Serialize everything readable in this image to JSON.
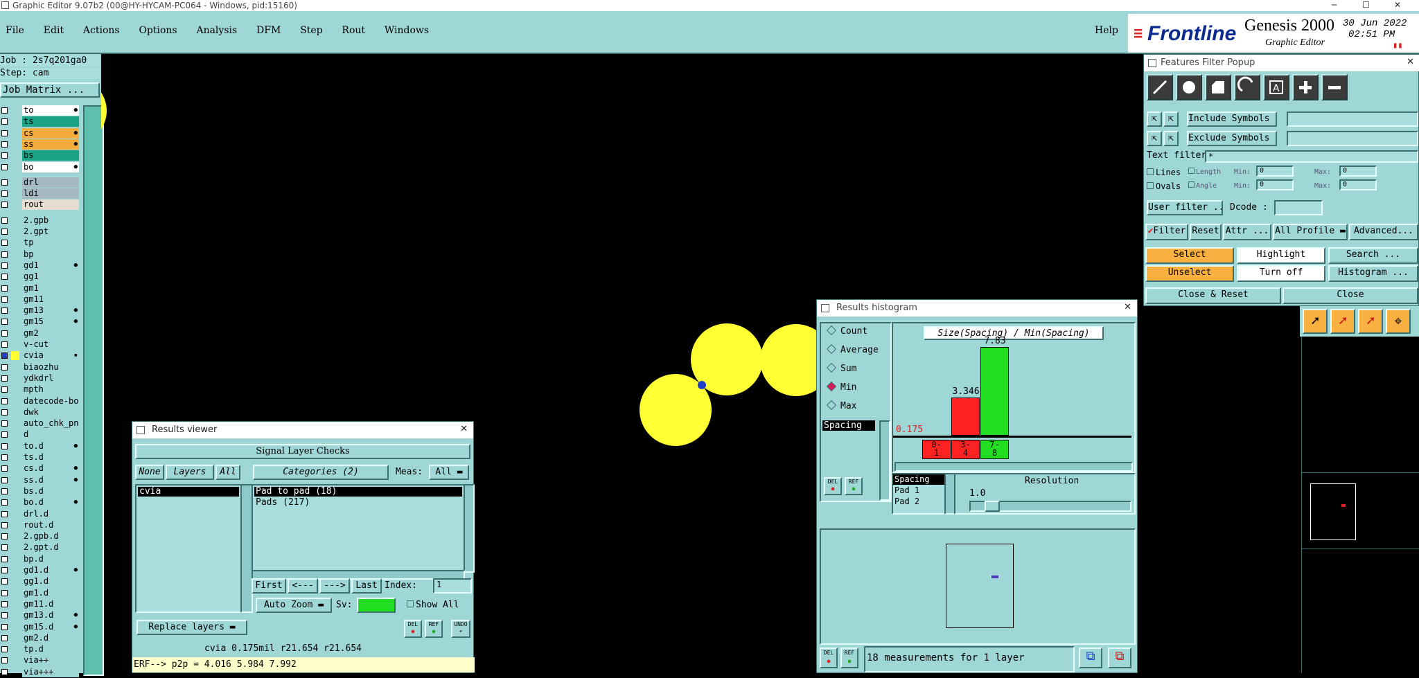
{
  "titlebar": {
    "title": "Graphic Editor 9.07b2 (00@HY-HYCAM-PC064 - Windows, pid:15160)"
  },
  "menu": {
    "items": [
      "File",
      "Edit",
      "Actions",
      "Options",
      "Analysis",
      "DFM",
      "Step",
      "Rout",
      "Windows"
    ],
    "help": "Help"
  },
  "brand": {
    "logo": "Frontline",
    "product": "Genesis 2000",
    "subtitle": "Graphic Editor",
    "date": "30 Jun 2022",
    "time": "02:51 PM"
  },
  "job": {
    "job_label": "Job : 2s7q201ga0",
    "step_label": "Step: cam",
    "matrix_button": "Job Matrix ..."
  },
  "layers": [
    {
      "name": "to",
      "color": "#ffffff",
      "flag": "●"
    },
    {
      "name": "ts",
      "color": "#1aa386",
      "flag": ""
    },
    {
      "name": "cs",
      "color": "#f4ad3c",
      "flag": "●"
    },
    {
      "name": "ss",
      "color": "#f4ad3c",
      "flag": "●"
    },
    {
      "name": "bs",
      "color": "#1aa386",
      "flag": ""
    },
    {
      "name": "bo",
      "color": "#ffffff",
      "flag": "●"
    },
    {
      "name": "drl",
      "color": "#a6b9c0",
      "flag": ""
    },
    {
      "name": "ldi",
      "color": "#a6b9c0",
      "flag": ""
    },
    {
      "name": "rout",
      "color": "#e6dcd2",
      "flag": ""
    },
    {
      "name": "2.gpb",
      "color": "#9fd6d6",
      "flag": ""
    },
    {
      "name": "2.gpt",
      "color": "#9fd6d6",
      "flag": ""
    },
    {
      "name": "tp",
      "color": "#9fd6d6",
      "flag": ""
    },
    {
      "name": "bp",
      "color": "#9fd6d6",
      "flag": ""
    },
    {
      "name": "gd1",
      "color": "#9fd6d6",
      "flag": "●"
    },
    {
      "name": "gg1",
      "color": "#9fd6d6",
      "flag": ""
    },
    {
      "name": "gm1",
      "color": "#9fd6d6",
      "flag": ""
    },
    {
      "name": "gm11",
      "color": "#9fd6d6",
      "flag": ""
    },
    {
      "name": "gm13",
      "color": "#9fd6d6",
      "flag": "●"
    },
    {
      "name": "gm15",
      "color": "#9fd6d6",
      "flag": "●"
    },
    {
      "name": "gm2",
      "color": "#9fd6d6",
      "flag": ""
    },
    {
      "name": "v-cut",
      "color": "#9fd6d6",
      "flag": ""
    },
    {
      "name": "cvia",
      "color": "#9fd6d6",
      "flag": "▪"
    },
    {
      "name": "biaozhu",
      "color": "#9fd6d6",
      "flag": ""
    },
    {
      "name": "ydkdrl",
      "color": "#9fd6d6",
      "flag": ""
    },
    {
      "name": "mpth",
      "color": "#9fd6d6",
      "flag": ""
    },
    {
      "name": "datecode-bo",
      "color": "#9fd6d6",
      "flag": ""
    },
    {
      "name": "dwk",
      "color": "#9fd6d6",
      "flag": ""
    },
    {
      "name": "auto_chk_pn",
      "color": "#9fd6d6",
      "flag": ""
    },
    {
      "name": "d",
      "color": "#9fd6d6",
      "flag": ""
    },
    {
      "name": "to.d",
      "color": "#9fd6d6",
      "flag": "●"
    },
    {
      "name": "ts.d",
      "color": "#9fd6d6",
      "flag": ""
    },
    {
      "name": "cs.d",
      "color": "#9fd6d6",
      "flag": "●"
    },
    {
      "name": "ss.d",
      "color": "#9fd6d6",
      "flag": "●"
    },
    {
      "name": "bs.d",
      "color": "#9fd6d6",
      "flag": ""
    },
    {
      "name": "bo.d",
      "color": "#9fd6d6",
      "flag": "●"
    },
    {
      "name": "drl.d",
      "color": "#9fd6d6",
      "flag": ""
    },
    {
      "name": "rout.d",
      "color": "#9fd6d6",
      "flag": ""
    },
    {
      "name": "2.gpb.d",
      "color": "#9fd6d6",
      "flag": ""
    },
    {
      "name": "2.gpt.d",
      "color": "#9fd6d6",
      "flag": ""
    },
    {
      "name": "bp.d",
      "color": "#9fd6d6",
      "flag": ""
    },
    {
      "name": "gd1.d",
      "color": "#9fd6d6",
      "flag": "●"
    },
    {
      "name": "gg1.d",
      "color": "#9fd6d6",
      "flag": ""
    },
    {
      "name": "gm1.d",
      "color": "#9fd6d6",
      "flag": ""
    },
    {
      "name": "gm11.d",
      "color": "#9fd6d6",
      "flag": ""
    },
    {
      "name": "gm13.d",
      "color": "#9fd6d6",
      "flag": "●"
    },
    {
      "name": "gm15.d",
      "color": "#9fd6d6",
      "flag": "●"
    },
    {
      "name": "gm2.d",
      "color": "#9fd6d6",
      "flag": ""
    },
    {
      "name": "tp.d",
      "color": "#9fd6d6",
      "flag": ""
    },
    {
      "name": "via++",
      "color": "#9fd6d6",
      "flag": ""
    },
    {
      "name": "via+++",
      "color": "#9fd6d6",
      "flag": ""
    }
  ],
  "filter_popup": {
    "title": "Features Filter Popup",
    "include_label": "Include Symbols :",
    "exclude_label": "Exclude Symbols :",
    "text_filter_label": "Text filter",
    "text_filter_value": "*",
    "lines_label": "Lines",
    "ovals_label": "Ovals",
    "length_label": "Length",
    "angle_label": "Angle",
    "min_label": "Min:",
    "max_label": "Max:",
    "zero": "0",
    "user_filter": "User filter ...",
    "dcode": "Dcode :",
    "filter": "Filter",
    "reset": "Reset",
    "attr": "Attr ...",
    "all_profile": "All Profile",
    "advanced": "Advanced...",
    "select": "Select",
    "highlight": "Highlight",
    "search": "Search ...",
    "unselect": "Unselect",
    "turn_off": "Turn off",
    "histogram": "Histogram ...",
    "close_reset": "Close & Reset",
    "close": "Close"
  },
  "results_viewer": {
    "title": "Results viewer",
    "header": "Signal Layer Checks",
    "none": "None",
    "layers": "Layers",
    "all": "All",
    "categories": "Categories (2)",
    "meas_label": "Meas:",
    "meas_value": "All",
    "layer_items": [
      "cvia"
    ],
    "category_items": [
      "Pad to pad (18)",
      "Pads (217)"
    ],
    "first": "First",
    "prev": "<---",
    "next": "--->",
    "last": "Last",
    "index_label": "Index:",
    "index_value": "1",
    "auto_zoom": "Auto Zoom",
    "sv_label": "Sv:",
    "show_all": "Show All",
    "replace_layers": "Replace layers",
    "del": "DEL",
    "ref": "REF",
    "undo": "UNDO",
    "status1": "cvia 0.175mil  r21.654  r21.654",
    "status2": "ERF--> p2p = 4.016 5.984 7.992"
  },
  "histogram": {
    "title": "Results histogram",
    "modes": [
      {
        "label": "Count",
        "selected": false
      },
      {
        "label": "Average",
        "selected": false
      },
      {
        "label": "Sum",
        "selected": false
      },
      {
        "label": "Min",
        "selected": true
      },
      {
        "label": "Max",
        "selected": false
      }
    ],
    "spacing_tag": "Spacing",
    "chart_title": "Size(Spacing) / Min(Spacing)",
    "min_label": "0.175",
    "bins": [
      {
        "label_top": "0-",
        "label_bottom": "1",
        "value": 0.175,
        "color": "#ff2222"
      },
      {
        "label_top": "3-",
        "label_bottom": "4",
        "value": 3.346,
        "color": "#ff2222"
      },
      {
        "label_top": "7-",
        "label_bottom": "8",
        "value": 7.83,
        "color": "#22dd22"
      }
    ],
    "bin_value_labels": [
      "",
      "3.346",
      "7.83"
    ],
    "list_items": [
      "Spacing",
      "Pad 1",
      "Pad 2"
    ],
    "resolution_label": "Resolution",
    "resolution_value": "1.0",
    "footer_text": "18 measurements for 1 layer",
    "del": "DEL",
    "ref": "REF"
  },
  "chart_data": {
    "type": "bar",
    "title": "Size(Spacing) / Min(Spacing)",
    "categories": [
      "0-1",
      "3-4",
      "7-8"
    ],
    "values": [
      0.175,
      3.346,
      7.83
    ],
    "ylim": [
      0,
      7.83
    ]
  },
  "colors": {
    "panel": "#9fd6d6",
    "accent_yellow": "#ffff33",
    "select_orange": "#f8b040",
    "green": "#22dd22",
    "red": "#ff2222"
  }
}
